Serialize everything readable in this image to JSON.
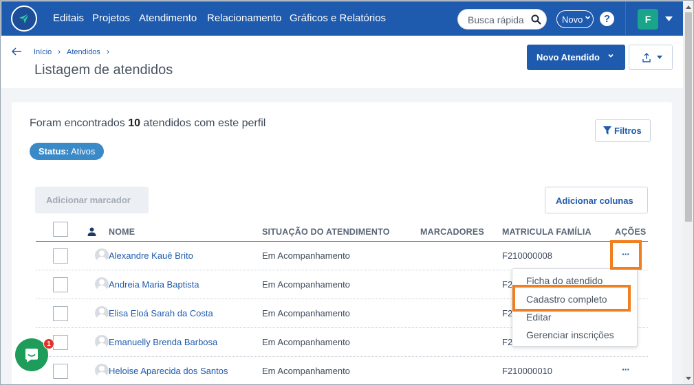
{
  "nav": {
    "items": [
      "Editais",
      "Projetos",
      "Atendimento",
      "Relacionamento",
      "Gráficos e Relatórios"
    ],
    "search_placeholder": "Busca rápida",
    "novo_label": "Novo",
    "help_label": "?",
    "user_initial": "F"
  },
  "breadcrumb": {
    "home": "Início",
    "current": "Atendidos"
  },
  "page_title": "Listagem de atendidos",
  "actions": {
    "novo_atendido": "Novo Atendido"
  },
  "summary": {
    "prefix": "Foram encontrados ",
    "count": "10",
    "suffix": " atendidos com este perfil"
  },
  "status_badge": {
    "label": "Status:",
    "value": " Ativos"
  },
  "filtros_label": "Filtros",
  "add_marcador_label": "Adicionar marcador",
  "add_colunas_label": "Adicionar colunas",
  "table": {
    "headers": {
      "nome": "NOME",
      "situacao": "SITUAÇÃO DO ATENDIMENTO",
      "marcadores": "MARCADORES",
      "matricula": "MATRICULA FAMÍLIA",
      "acoes": "AÇÕES"
    },
    "rows": [
      {
        "nome": "Alexandre Kauê Brito",
        "situacao": "Em Acompanhamento",
        "matricula": "F210000008",
        "acao": "···"
      },
      {
        "nome": "Andreia Maria Baptista",
        "situacao": "Em Acompanhamento",
        "matricula": "F2",
        "acao": ""
      },
      {
        "nome": "Elisa Eloá Sarah da Costa",
        "situacao": "Em Acompanhamento",
        "matricula": "F2",
        "acao": ""
      },
      {
        "nome": "Emanuelly Brenda Barbosa",
        "situacao": "Em Acompanhamento",
        "matricula": "F2",
        "acao": ""
      },
      {
        "nome": "Heloise Aparecida dos Santos",
        "situacao": "Em Acompanhamento",
        "matricula": "F210000010",
        "acao": "···"
      }
    ]
  },
  "dropdown": [
    "Ficha do atendido",
    "Cadastro completo",
    "Editar",
    "Gerenciar inscrições"
  ],
  "chat_badge": "1",
  "colors": {
    "brand": "#1e5aad",
    "highlight": "#f07f22",
    "chat": "#1d9c5a"
  }
}
